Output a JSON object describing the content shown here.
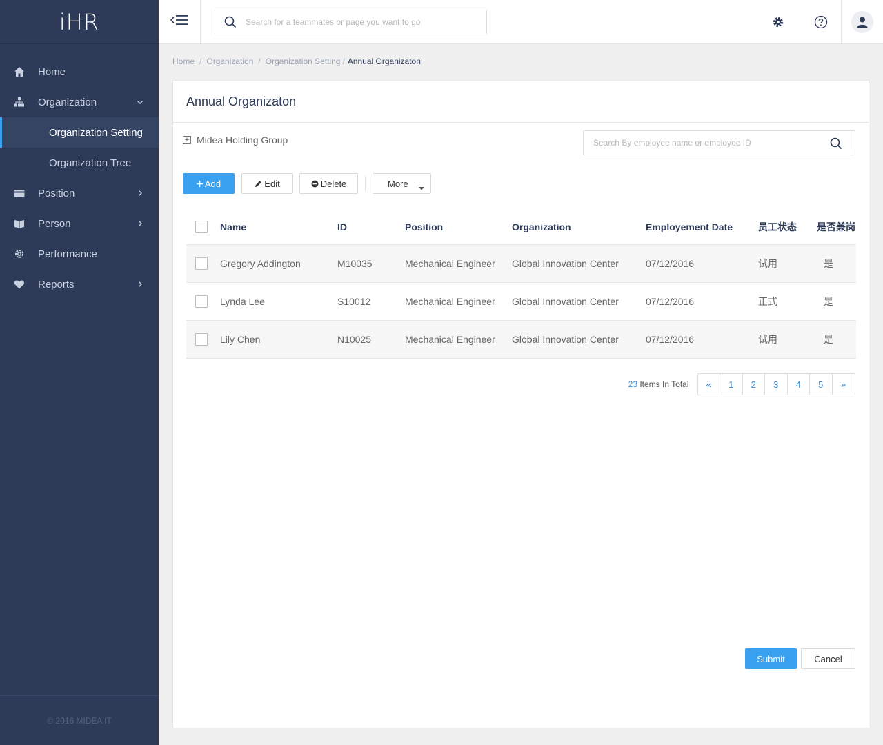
{
  "app": {
    "logo": "iHR",
    "footer": "© 2016 MIDEA IT"
  },
  "sidebar": {
    "items": [
      {
        "label": "Home",
        "icon": "home-icon"
      },
      {
        "label": "Organization",
        "icon": "org-chart-icon",
        "expanded": true,
        "children": [
          {
            "label": "Organization Setting",
            "active": true
          },
          {
            "label": "Organization Tree"
          }
        ]
      },
      {
        "label": "Position",
        "icon": "card-icon"
      },
      {
        "label": "Person",
        "icon": "book-icon"
      },
      {
        "label": "Performance",
        "icon": "gear-icon"
      },
      {
        "label": "Reports",
        "icon": "heart-icon"
      }
    ]
  },
  "topbar": {
    "search_placeholder": "Search for a teammates or page you want to go"
  },
  "breadcrumb": [
    "Home",
    "Organization",
    "Organization Setting",
    "Annual Organizaton"
  ],
  "page": {
    "title": "Annual Organizaton",
    "tree_root": "Midea Holding Group",
    "emp_search_placeholder": "Search By employee name or employee ID",
    "buttons": {
      "add": "Add",
      "edit": "Edit",
      "delete": "Delete",
      "more": "More"
    }
  },
  "table": {
    "headers": [
      "Name",
      "ID",
      "Position",
      "Organization",
      "Employement Date",
      "员工状态",
      "是否兼岗"
    ],
    "rows": [
      [
        "Gregory Addington",
        "M10035",
        "Mechanical Engineer",
        "Global Innovation Center",
        "07/12/2016",
        "试用",
        "是"
      ],
      [
        "Lynda Lee",
        "S10012",
        "Mechanical Engineer",
        "Global Innovation Center",
        "07/12/2016",
        "正式",
        "是"
      ],
      [
        "Lily Chen",
        "N10025",
        "Mechanical Engineer",
        "Global Innovation Center",
        "07/12/2016",
        "试用",
        "是"
      ]
    ]
  },
  "pagination": {
    "total": "23",
    "total_label": "Items In Total",
    "pages": [
      "«",
      "1",
      "2",
      "3",
      "4",
      "5",
      "»"
    ]
  },
  "form_actions": {
    "submit": "Submit",
    "cancel": "Cancel"
  },
  "colors": {
    "sidebar": "#2d3b59",
    "accent": "#3aa0f0",
    "link": "#3a8fd8"
  }
}
